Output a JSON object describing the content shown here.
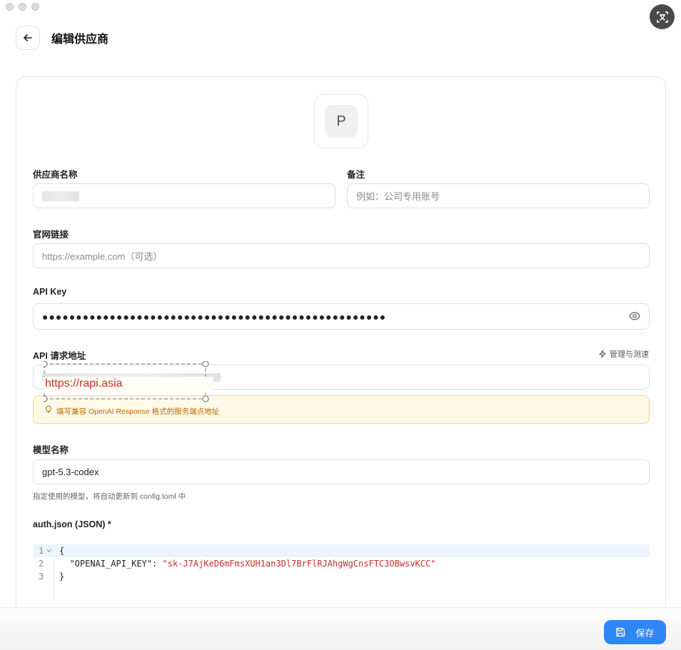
{
  "header": {
    "title": "编辑供应商"
  },
  "avatar": {
    "letter": "P"
  },
  "fields": {
    "provider_name": {
      "label": "供应商名称"
    },
    "note": {
      "label": "备注",
      "placeholder": "例如：公司专用账号"
    },
    "website": {
      "label": "官网链接",
      "placeholder": "https://example.com（可选）"
    },
    "api_key": {
      "label": "API Key",
      "value": "●●●●●●●●●●●●●●●●●●●●●●●●●●●●●●●●●●●●●●●●●●●●●●●●●●●"
    },
    "api_url": {
      "label": "API 请求地址",
      "manage_label": "管理与测速",
      "overlay_text": "https://rapi.asia",
      "hint": "填写兼容 OpenAI Response 格式的服务端点地址"
    },
    "model": {
      "label": "模型名称",
      "value": "gpt-5.3-codex",
      "help": "指定使用的模型，将自动更新到 config.toml 中"
    }
  },
  "auth_json": {
    "label": "auth.json (JSON) *",
    "lines": [
      {
        "num": "1",
        "text": "{"
      },
      {
        "num": "2",
        "key": "  \"OPENAI_API_KEY\": ",
        "value": "\"sk-J7AjKeD6mFmsXUH1an3Dl7BrFlRJAhgWgCnsFTC3OBwsvKCC\""
      },
      {
        "num": "3",
        "text": "}"
      }
    ]
  },
  "footer": {
    "save_label": "保存"
  },
  "colors": {
    "accent": "#2f86f6",
    "hint_bg": "#fff9e8",
    "hint_text": "#b86a00",
    "string": "#c0312b"
  }
}
